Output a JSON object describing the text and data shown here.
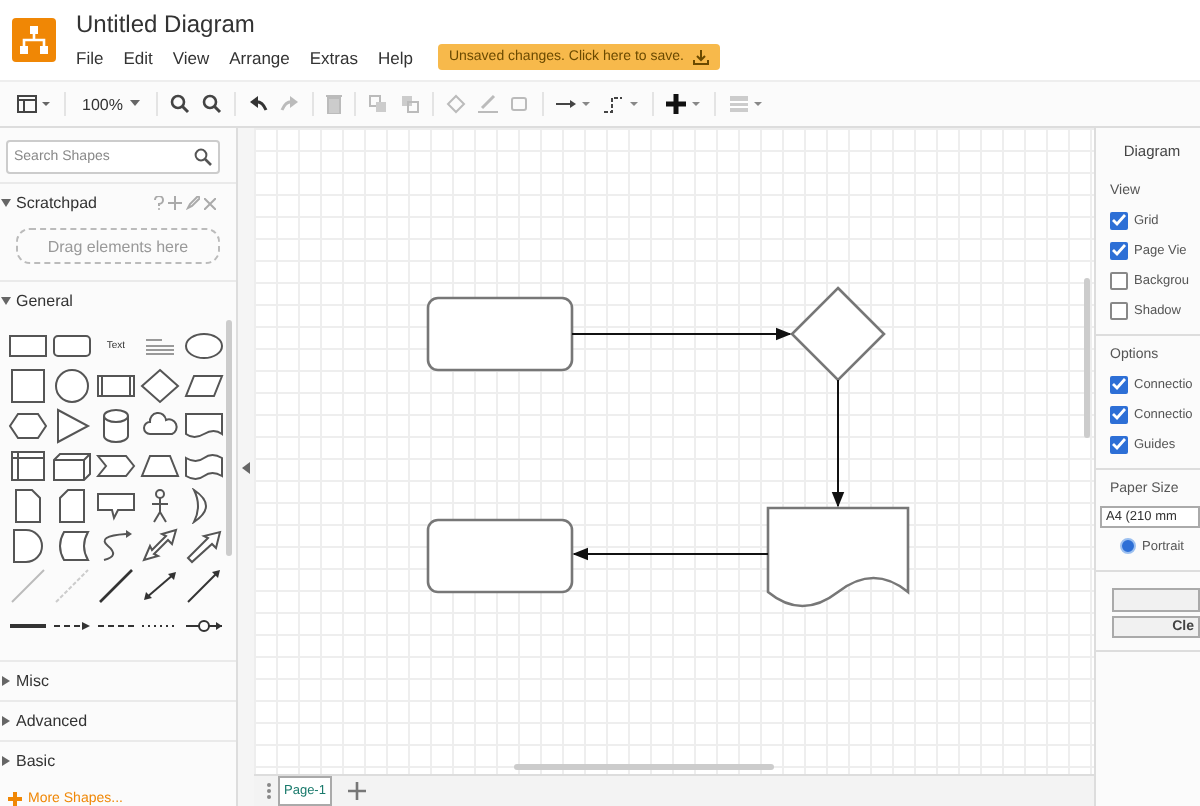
{
  "app": {
    "title": "Untitled Diagram"
  },
  "menu": [
    "File",
    "Edit",
    "View",
    "Arrange",
    "Extras",
    "Help"
  ],
  "save_banner": "Unsaved changes. Click here to save.",
  "toolbar": {
    "zoom": "100%"
  },
  "sidebar": {
    "search": {
      "placeholder": "Search Shapes"
    },
    "scratchpad": {
      "title": "Scratchpad",
      "expanded": true,
      "drop_hint": "Drag elements here"
    },
    "sections": [
      {
        "title": "General",
        "expanded": true
      },
      {
        "title": "Misc",
        "expanded": false
      },
      {
        "title": "Advanced",
        "expanded": false
      },
      {
        "title": "Basic",
        "expanded": false
      }
    ],
    "text_shape_label": "Text",
    "more_shapes": "More Shapes..."
  },
  "pages": [
    {
      "label": "Page-1",
      "selected": true
    }
  ],
  "format_panel": {
    "title": "Diagram",
    "groups": [
      {
        "title": "View",
        "items": [
          {
            "kind": "checkbox",
            "label": "Grid",
            "checked": true
          },
          {
            "kind": "checkbox",
            "label": "Page Vie",
            "checked": true
          },
          {
            "kind": "checkbox",
            "label": "Backgrou",
            "checked": false
          },
          {
            "kind": "checkbox",
            "label": "Shadow",
            "checked": false
          }
        ]
      },
      {
        "title": "Options",
        "items": [
          {
            "kind": "checkbox",
            "label": "Connectio",
            "checked": true
          },
          {
            "kind": "checkbox",
            "label": "Connectio",
            "checked": true
          },
          {
            "kind": "checkbox",
            "label": "Guides",
            "checked": true
          }
        ]
      },
      {
        "title": "Paper Size",
        "items": [
          {
            "kind": "select",
            "label": "A4 (210 mm"
          },
          {
            "kind": "radio",
            "label": "Portrait",
            "selected": true
          }
        ]
      }
    ],
    "buttons": [
      {
        "kind": "blank"
      },
      {
        "kind": "text",
        "label": "Cle"
      }
    ]
  }
}
